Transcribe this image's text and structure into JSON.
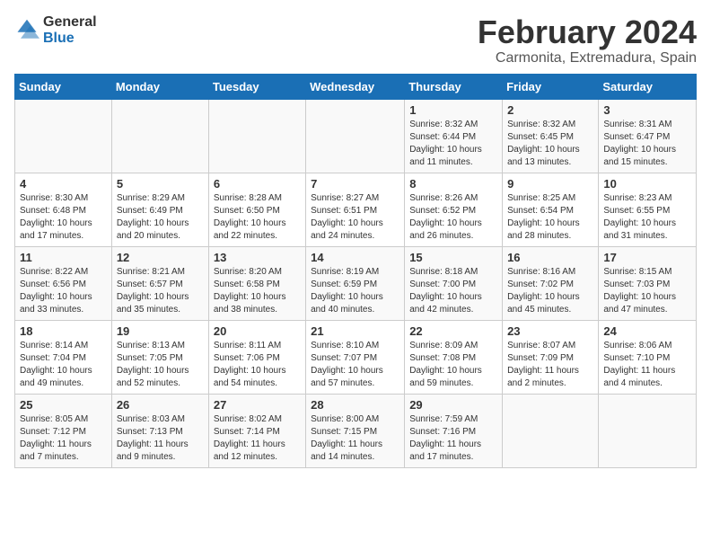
{
  "logo": {
    "line1": "General",
    "line2": "Blue"
  },
  "title": "February 2024",
  "subtitle": "Carmonita, Extremadura, Spain",
  "headers": [
    "Sunday",
    "Monday",
    "Tuesday",
    "Wednesday",
    "Thursday",
    "Friday",
    "Saturday"
  ],
  "weeks": [
    [
      {
        "day": "",
        "info": ""
      },
      {
        "day": "",
        "info": ""
      },
      {
        "day": "",
        "info": ""
      },
      {
        "day": "",
        "info": ""
      },
      {
        "day": "1",
        "info": "Sunrise: 8:32 AM\nSunset: 6:44 PM\nDaylight: 10 hours\nand 11 minutes."
      },
      {
        "day": "2",
        "info": "Sunrise: 8:32 AM\nSunset: 6:45 PM\nDaylight: 10 hours\nand 13 minutes."
      },
      {
        "day": "3",
        "info": "Sunrise: 8:31 AM\nSunset: 6:47 PM\nDaylight: 10 hours\nand 15 minutes."
      }
    ],
    [
      {
        "day": "4",
        "info": "Sunrise: 8:30 AM\nSunset: 6:48 PM\nDaylight: 10 hours\nand 17 minutes."
      },
      {
        "day": "5",
        "info": "Sunrise: 8:29 AM\nSunset: 6:49 PM\nDaylight: 10 hours\nand 20 minutes."
      },
      {
        "day": "6",
        "info": "Sunrise: 8:28 AM\nSunset: 6:50 PM\nDaylight: 10 hours\nand 22 minutes."
      },
      {
        "day": "7",
        "info": "Sunrise: 8:27 AM\nSunset: 6:51 PM\nDaylight: 10 hours\nand 24 minutes."
      },
      {
        "day": "8",
        "info": "Sunrise: 8:26 AM\nSunset: 6:52 PM\nDaylight: 10 hours\nand 26 minutes."
      },
      {
        "day": "9",
        "info": "Sunrise: 8:25 AM\nSunset: 6:54 PM\nDaylight: 10 hours\nand 28 minutes."
      },
      {
        "day": "10",
        "info": "Sunrise: 8:23 AM\nSunset: 6:55 PM\nDaylight: 10 hours\nand 31 minutes."
      }
    ],
    [
      {
        "day": "11",
        "info": "Sunrise: 8:22 AM\nSunset: 6:56 PM\nDaylight: 10 hours\nand 33 minutes."
      },
      {
        "day": "12",
        "info": "Sunrise: 8:21 AM\nSunset: 6:57 PM\nDaylight: 10 hours\nand 35 minutes."
      },
      {
        "day": "13",
        "info": "Sunrise: 8:20 AM\nSunset: 6:58 PM\nDaylight: 10 hours\nand 38 minutes."
      },
      {
        "day": "14",
        "info": "Sunrise: 8:19 AM\nSunset: 6:59 PM\nDaylight: 10 hours\nand 40 minutes."
      },
      {
        "day": "15",
        "info": "Sunrise: 8:18 AM\nSunset: 7:00 PM\nDaylight: 10 hours\nand 42 minutes."
      },
      {
        "day": "16",
        "info": "Sunrise: 8:16 AM\nSunset: 7:02 PM\nDaylight: 10 hours\nand 45 minutes."
      },
      {
        "day": "17",
        "info": "Sunrise: 8:15 AM\nSunset: 7:03 PM\nDaylight: 10 hours\nand 47 minutes."
      }
    ],
    [
      {
        "day": "18",
        "info": "Sunrise: 8:14 AM\nSunset: 7:04 PM\nDaylight: 10 hours\nand 49 minutes."
      },
      {
        "day": "19",
        "info": "Sunrise: 8:13 AM\nSunset: 7:05 PM\nDaylight: 10 hours\nand 52 minutes."
      },
      {
        "day": "20",
        "info": "Sunrise: 8:11 AM\nSunset: 7:06 PM\nDaylight: 10 hours\nand 54 minutes."
      },
      {
        "day": "21",
        "info": "Sunrise: 8:10 AM\nSunset: 7:07 PM\nDaylight: 10 hours\nand 57 minutes."
      },
      {
        "day": "22",
        "info": "Sunrise: 8:09 AM\nSunset: 7:08 PM\nDaylight: 10 hours\nand 59 minutes."
      },
      {
        "day": "23",
        "info": "Sunrise: 8:07 AM\nSunset: 7:09 PM\nDaylight: 11 hours\nand 2 minutes."
      },
      {
        "day": "24",
        "info": "Sunrise: 8:06 AM\nSunset: 7:10 PM\nDaylight: 11 hours\nand 4 minutes."
      }
    ],
    [
      {
        "day": "25",
        "info": "Sunrise: 8:05 AM\nSunset: 7:12 PM\nDaylight: 11 hours\nand 7 minutes."
      },
      {
        "day": "26",
        "info": "Sunrise: 8:03 AM\nSunset: 7:13 PM\nDaylight: 11 hours\nand 9 minutes."
      },
      {
        "day": "27",
        "info": "Sunrise: 8:02 AM\nSunset: 7:14 PM\nDaylight: 11 hours\nand 12 minutes."
      },
      {
        "day": "28",
        "info": "Sunrise: 8:00 AM\nSunset: 7:15 PM\nDaylight: 11 hours\nand 14 minutes."
      },
      {
        "day": "29",
        "info": "Sunrise: 7:59 AM\nSunset: 7:16 PM\nDaylight: 11 hours\nand 17 minutes."
      },
      {
        "day": "",
        "info": ""
      },
      {
        "day": "",
        "info": ""
      }
    ]
  ]
}
